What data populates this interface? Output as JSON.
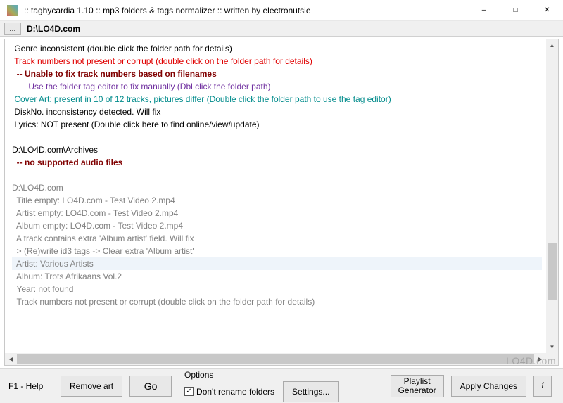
{
  "window": {
    "title": ":: taghycardia 1.10  :: mp3 folders & tags normalizer :: written by electronutsie"
  },
  "pathbar": {
    "dots": "...",
    "path": "D:\\LO4D.com"
  },
  "log": {
    "lines": [
      {
        "text": " Genre inconsistent (double click the folder path for details)",
        "cls": "c-black"
      },
      {
        "text": " Track numbers not present or corrupt (double click on the folder path for details)",
        "cls": "c-red"
      },
      {
        "text": "  -- Unable to fix track numbers based on filenames",
        "cls": "c-maroon"
      },
      {
        "text": "       Use the folder tag editor to fix manually (Dbl click the folder path)",
        "cls": "c-purple"
      },
      {
        "text": " Cover Art: present in 10 of 12 tracks, pictures differ (Double click the folder path to use the tag editor)",
        "cls": "c-teal"
      },
      {
        "text": " DiskNo. inconsistency detected. Will fix",
        "cls": "c-black"
      },
      {
        "text": " Lyrics: NOT present (Double click here to find online/view/update)",
        "cls": "c-black"
      },
      {
        "text": " ",
        "cls": "c-black"
      },
      {
        "text": "D:\\LO4D.com\\Archives",
        "cls": "c-black"
      },
      {
        "text": "  -- no supported audio files",
        "cls": "c-maroon"
      },
      {
        "text": " ",
        "cls": "c-black"
      },
      {
        "text": "D:\\LO4D.com",
        "cls": "c-gray"
      },
      {
        "text": "  Title empty: LO4D.com - Test Video 2.mp4",
        "cls": "c-gray"
      },
      {
        "text": "  Artist empty: LO4D.com - Test Video 2.mp4",
        "cls": "c-gray"
      },
      {
        "text": "  Album empty: LO4D.com - Test Video 2.mp4",
        "cls": "c-gray"
      },
      {
        "text": "  A track contains extra 'Album artist' field. Will fix",
        "cls": "c-gray"
      },
      {
        "text": "  > (Re)write id3 tags -> Clear extra 'Album artist'",
        "cls": "c-gray"
      },
      {
        "text": "  Artist: Various Artists",
        "cls": "c-gray",
        "hl": true
      },
      {
        "text": "  Album: Trots Afrikaans Vol.2",
        "cls": "c-gray"
      },
      {
        "text": "  Year: not found",
        "cls": "c-gray"
      },
      {
        "text": "  Track numbers not present or corrupt (double click on the folder path for details)",
        "cls": "c-gray"
      }
    ]
  },
  "bottombar": {
    "help": "F1 - Help",
    "remove_art": "Remove art",
    "go": "Go",
    "options_label": "Options",
    "dont_rename": "Don't rename folders",
    "settings": "Settings...",
    "playlist1": "Playlist",
    "playlist2": "Generator",
    "apply": "Apply Changes",
    "info": "i"
  },
  "watermark": "LO4D.com"
}
